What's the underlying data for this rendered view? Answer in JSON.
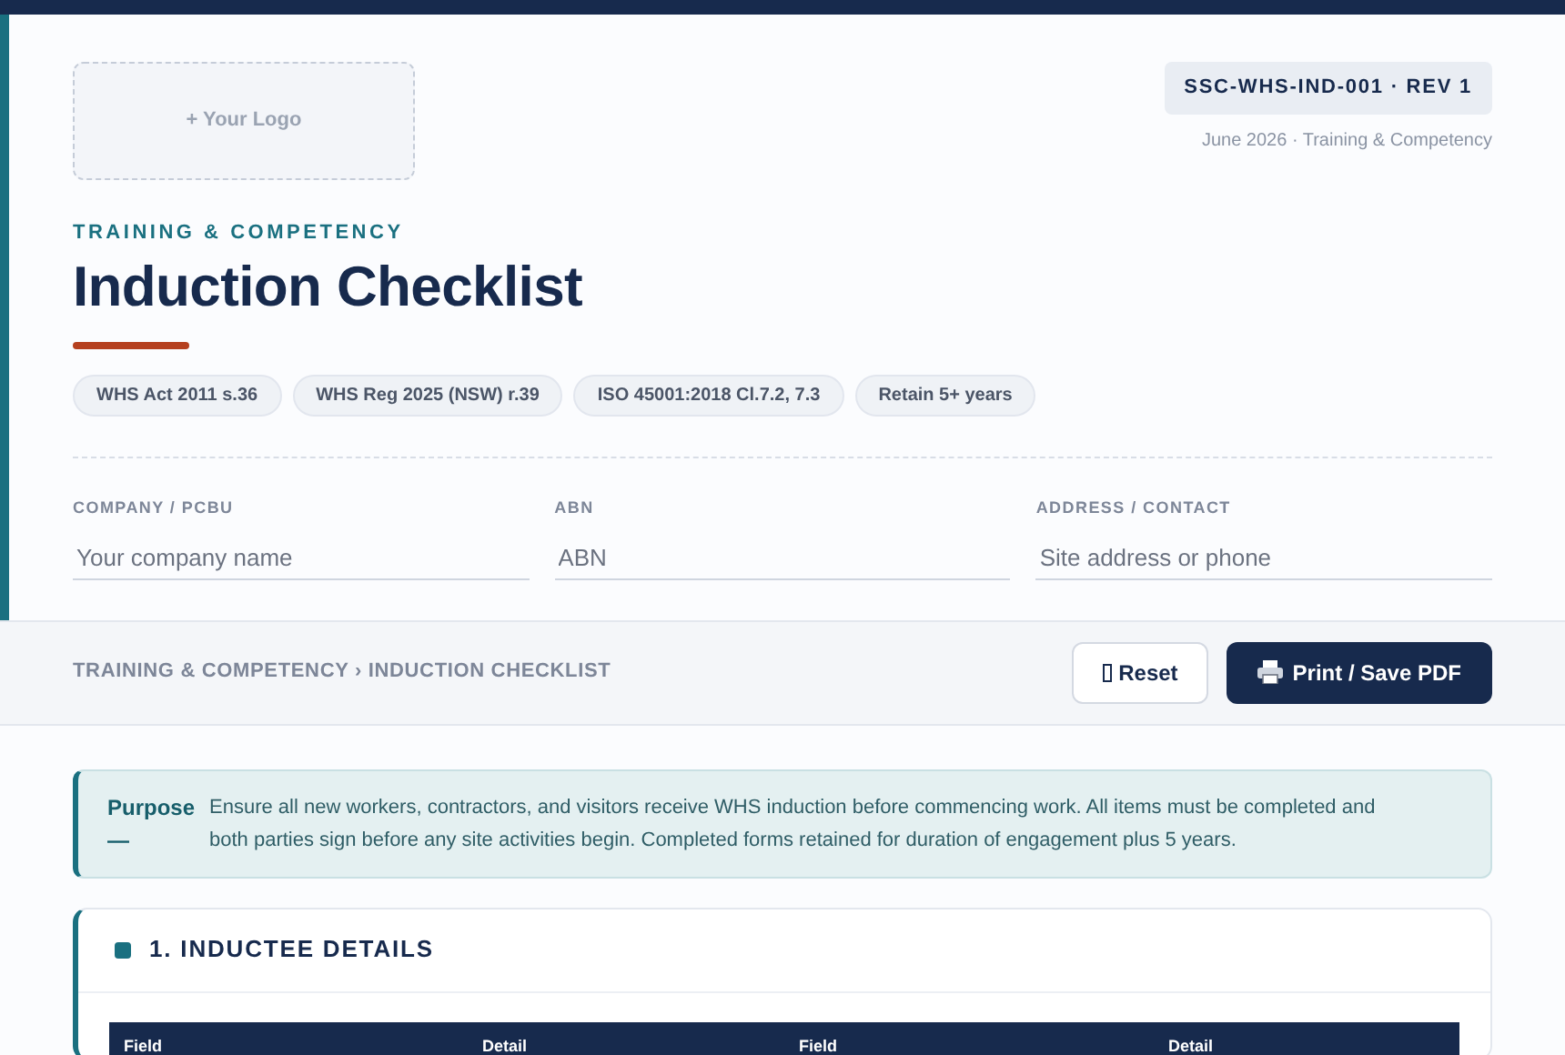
{
  "header": {
    "logo_placeholder": "+ Your Logo",
    "doc_code": "SSC-WHS-IND-001 · REV 1",
    "doc_meta": "June 2026 · Training & Competency",
    "eyebrow": "TRAINING & COMPETENCY",
    "title": "Induction Checklist",
    "chips": [
      "WHS Act 2011 s.36",
      "WHS Reg 2025 (NSW) r.39",
      "ISO 45001:2018 Cl.7.2, 7.3",
      "Retain 5+ years"
    ],
    "fields": [
      {
        "label": "COMPANY / PCBU",
        "placeholder": "Your company name"
      },
      {
        "label": "ABN",
        "placeholder": "ABN"
      },
      {
        "label": "ADDRESS / CONTACT",
        "placeholder": "Site address or phone"
      }
    ]
  },
  "toolbar": {
    "breadcrumb": "TRAINING & COMPETENCY › INDUCTION CHECKLIST",
    "buttons": [
      {
        "kind": "reset",
        "label": "Reset"
      },
      {
        "kind": "print",
        "label": "Print / Save PDF"
      }
    ]
  },
  "purpose": {
    "label": "Purpose —",
    "text": "Ensure all new workers, contractors, and visitors receive WHS induction before commencing work. All items must be completed and both parties sign before any site activities begin. Completed forms retained for duration of engagement plus 5 years."
  },
  "section": {
    "title": "1. INDUCTEE DETAILS",
    "table": {
      "columns": [
        "Field",
        "Detail",
        "Field",
        "Detail"
      ]
    }
  }
}
